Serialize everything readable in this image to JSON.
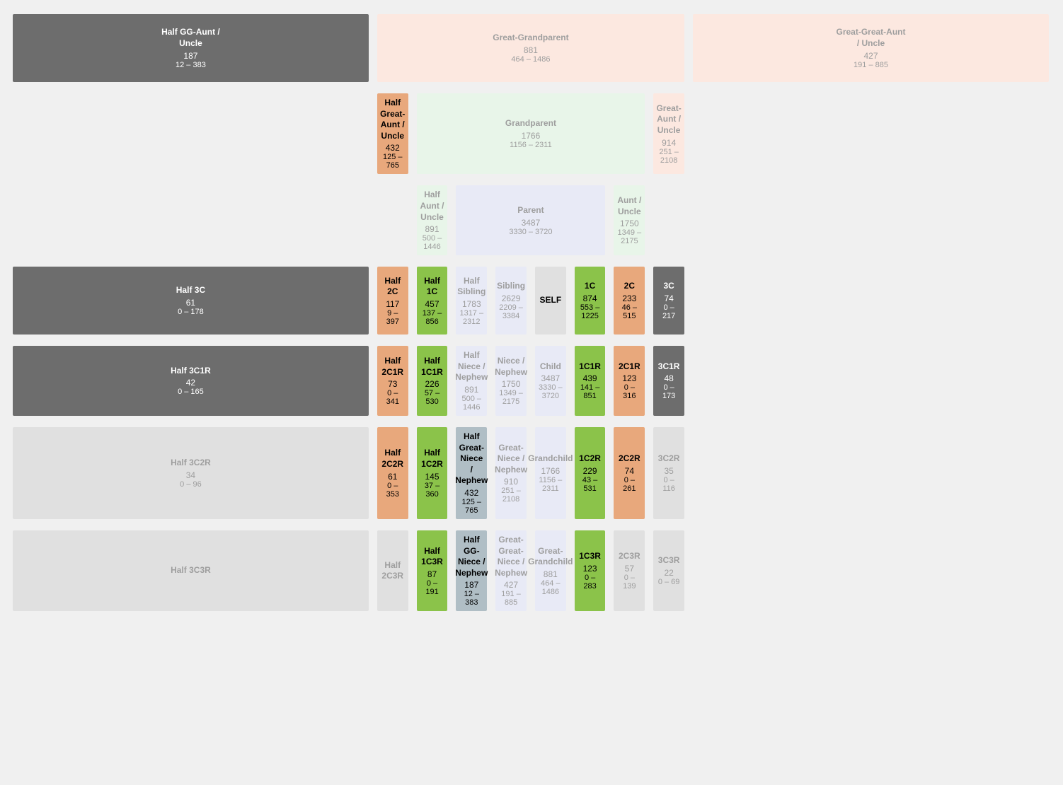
{
  "cells": {
    "r0": [
      {
        "id": "half-gg-aunt-uncle",
        "name": "Half GG-Aunt /\nUncle",
        "avg": "187",
        "range": "12 – 383",
        "style": "c-gray-dark",
        "colspan": 1,
        "rowspan": 1
      },
      {
        "id": "great-grandparent",
        "name": "Great-Grandparent",
        "avg": "881",
        "range": "464 – 1486",
        "style": "c-peach-bg text-muted",
        "colspan": 8,
        "rowspan": 1
      },
      {
        "id": "great-great-aunt-uncle",
        "name": "Great-Great-Aunt\n/ Uncle",
        "avg": "427",
        "range": "191 – 885",
        "style": "c-peach-bg text-muted",
        "colspan": 1,
        "rowspan": 1
      }
    ],
    "r1": [
      {
        "id": "empty-r1-0",
        "name": "",
        "style": "c-empty",
        "colspan": 1
      },
      {
        "id": "half-great-aunt-uncle",
        "name": "Half Great-Aunt /\nUncle",
        "avg": "432",
        "range": "125 – 765",
        "style": "c-orange",
        "colspan": 1
      },
      {
        "id": "grandparent",
        "name": "Grandparent",
        "avg": "1766",
        "range": "1156 – 2311",
        "style": "c-green-bg text-muted",
        "colspan": 6
      },
      {
        "id": "great-aunt-uncle",
        "name": "Great-Aunt /\nUncle",
        "avg": "914",
        "range": "251 – 2108",
        "style": "c-peach-bg text-muted",
        "colspan": 1
      }
    ],
    "r2": [
      {
        "id": "empty-r2-0",
        "name": "",
        "style": "c-empty",
        "colspan": 2
      },
      {
        "id": "half-aunt-uncle",
        "name": "Half Aunt / Uncle",
        "avg": "891",
        "range": "500 – 1446",
        "style": "c-green-bg text-muted",
        "colspan": 1
      },
      {
        "id": "parent",
        "name": "Parent",
        "avg": "3487",
        "range": "3330 – 3720",
        "style": "c-blue-bg text-muted",
        "colspan": 4
      },
      {
        "id": "aunt-uncle",
        "name": "Aunt / Uncle",
        "avg": "1750",
        "range": "1349 – 2175",
        "style": "c-green-bg text-muted",
        "colspan": 1
      },
      {
        "id": "empty-r2-end",
        "name": "",
        "style": "c-empty",
        "colspan": 2
      }
    ],
    "r3": [
      {
        "id": "half-3c",
        "name": "Half 3C",
        "avg": "61",
        "range": "0 – 178",
        "style": "c-gray-dark"
      },
      {
        "id": "half-2c",
        "name": "Half 2C",
        "avg": "117",
        "range": "9 – 397",
        "style": "c-orange"
      },
      {
        "id": "half-1c",
        "name": "Half 1C",
        "avg": "457",
        "range": "137 – 856",
        "style": "c-green"
      },
      {
        "id": "half-sibling",
        "name": "Half Sibling",
        "avg": "1783",
        "range": "1317 – 2312",
        "style": "c-blue-bg text-muted"
      },
      {
        "id": "sibling",
        "name": "Sibling",
        "avg": "2629",
        "range": "2209 – 3384",
        "style": "c-blue-bg text-muted"
      },
      {
        "id": "self",
        "name": "SELF",
        "avg": "",
        "range": "",
        "style": "c-self"
      },
      {
        "id": "1c",
        "name": "1C",
        "avg": "874",
        "range": "553 – 1225",
        "style": "c-green"
      },
      {
        "id": "2c",
        "name": "2C",
        "avg": "233",
        "range": "46 – 515",
        "style": "c-orange"
      },
      {
        "id": "3c",
        "name": "3C",
        "avg": "74",
        "range": "0 – 217",
        "style": "c-gray-dark"
      },
      {
        "id": "empty-r3-end",
        "name": "",
        "style": "c-empty"
      }
    ],
    "r4": [
      {
        "id": "half-3c1r",
        "name": "Half 3C1R",
        "avg": "42",
        "range": "0 – 165",
        "style": "c-gray-dark"
      },
      {
        "id": "half-2c1r",
        "name": "Half 2C1R",
        "avg": "73",
        "range": "0 – 341",
        "style": "c-orange"
      },
      {
        "id": "half-1c1r",
        "name": "Half 1C1R",
        "avg": "226",
        "range": "57 – 530",
        "style": "c-green"
      },
      {
        "id": "half-niece-nephew",
        "name": "Half Niece /\nNephew",
        "avg": "891",
        "range": "500 – 1446",
        "style": "c-blue-bg text-muted"
      },
      {
        "id": "niece-nephew",
        "name": "Niece / Nephew",
        "avg": "1750",
        "range": "1349 – 2175",
        "style": "c-blue-bg text-muted"
      },
      {
        "id": "child",
        "name": "Child",
        "avg": "3487",
        "range": "3330 – 3720",
        "style": "c-blue-bg text-muted"
      },
      {
        "id": "1c1r",
        "name": "1C1R",
        "avg": "439",
        "range": "141 – 851",
        "style": "c-green"
      },
      {
        "id": "2c1r",
        "name": "2C1R",
        "avg": "123",
        "range": "0 – 316",
        "style": "c-orange"
      },
      {
        "id": "3c1r",
        "name": "3C1R",
        "avg": "48",
        "range": "0 – 173",
        "style": "c-gray-dark"
      },
      {
        "id": "empty-r4-end",
        "name": "",
        "style": "c-empty"
      }
    ],
    "r5": [
      {
        "id": "half-3c2r",
        "name": "Half 3C2R",
        "avg": "34",
        "range": "0 – 96",
        "style": "c-light-gray"
      },
      {
        "id": "half-2c2r",
        "name": "Half 2C2R",
        "avg": "61",
        "range": "0 – 353",
        "style": "c-orange"
      },
      {
        "id": "half-1c2r",
        "name": "Half 1C2R",
        "avg": "145",
        "range": "37 – 360",
        "style": "c-green"
      },
      {
        "id": "half-great-niece-nephew",
        "name": "Half Great-Niece\n/ Nephew",
        "avg": "432",
        "range": "125 – 765",
        "style": "c-blue-bg"
      },
      {
        "id": "great-niece-nephew",
        "name": "Great-Niece /\nNephew",
        "avg": "910",
        "range": "251 – 2108",
        "style": "c-blue-bg text-muted"
      },
      {
        "id": "grandchild",
        "name": "Grandchild",
        "avg": "1766",
        "range": "1156 – 2311",
        "style": "c-blue-bg text-muted"
      },
      {
        "id": "1c2r",
        "name": "1C2R",
        "avg": "229",
        "range": "43 – 531",
        "style": "c-green"
      },
      {
        "id": "2c2r",
        "name": "2C2R",
        "avg": "74",
        "range": "0 – 261",
        "style": "c-orange"
      },
      {
        "id": "3c2r",
        "name": "3C2R",
        "avg": "35",
        "range": "0 – 116",
        "style": "c-light-gray"
      },
      {
        "id": "empty-r5-end",
        "name": "",
        "style": "c-empty"
      }
    ],
    "r6": [
      {
        "id": "half-3c3r-empty",
        "name": "Half 3C3R",
        "avg": "",
        "range": "",
        "style": "c-light-gray"
      },
      {
        "id": "half-2c3r-empty",
        "name": "Half 2C3R",
        "avg": "",
        "range": "",
        "style": "c-light-gray"
      },
      {
        "id": "half-1c3r",
        "name": "Half 1C3R",
        "avg": "87",
        "range": "0 – 191",
        "style": "c-green"
      },
      {
        "id": "half-gg-niece-nephew",
        "name": "Half GG-Niece /\nNephew",
        "avg": "187",
        "range": "12 – 383",
        "style": "c-blue-bg"
      },
      {
        "id": "great-great-niece-nephew",
        "name": "Great-Great-\nNiece / Nephew",
        "avg": "427",
        "range": "191 – 885",
        "style": "c-blue-bg text-muted"
      },
      {
        "id": "great-grandchild",
        "name": "Great-Grandchild",
        "avg": "881",
        "range": "464 – 1486",
        "style": "c-blue-bg text-muted"
      },
      {
        "id": "1c3r",
        "name": "1C3R",
        "avg": "123",
        "range": "0 – 283",
        "style": "c-green"
      },
      {
        "id": "2c3r",
        "name": "2C3R",
        "avg": "57",
        "range": "0 – 139",
        "style": "c-light-gray"
      },
      {
        "id": "3c3r",
        "name": "3C3R",
        "avg": "22",
        "range": "0 – 69",
        "style": "c-light-gray"
      },
      {
        "id": "empty-r6-end",
        "name": "",
        "style": "c-empty"
      }
    ]
  }
}
